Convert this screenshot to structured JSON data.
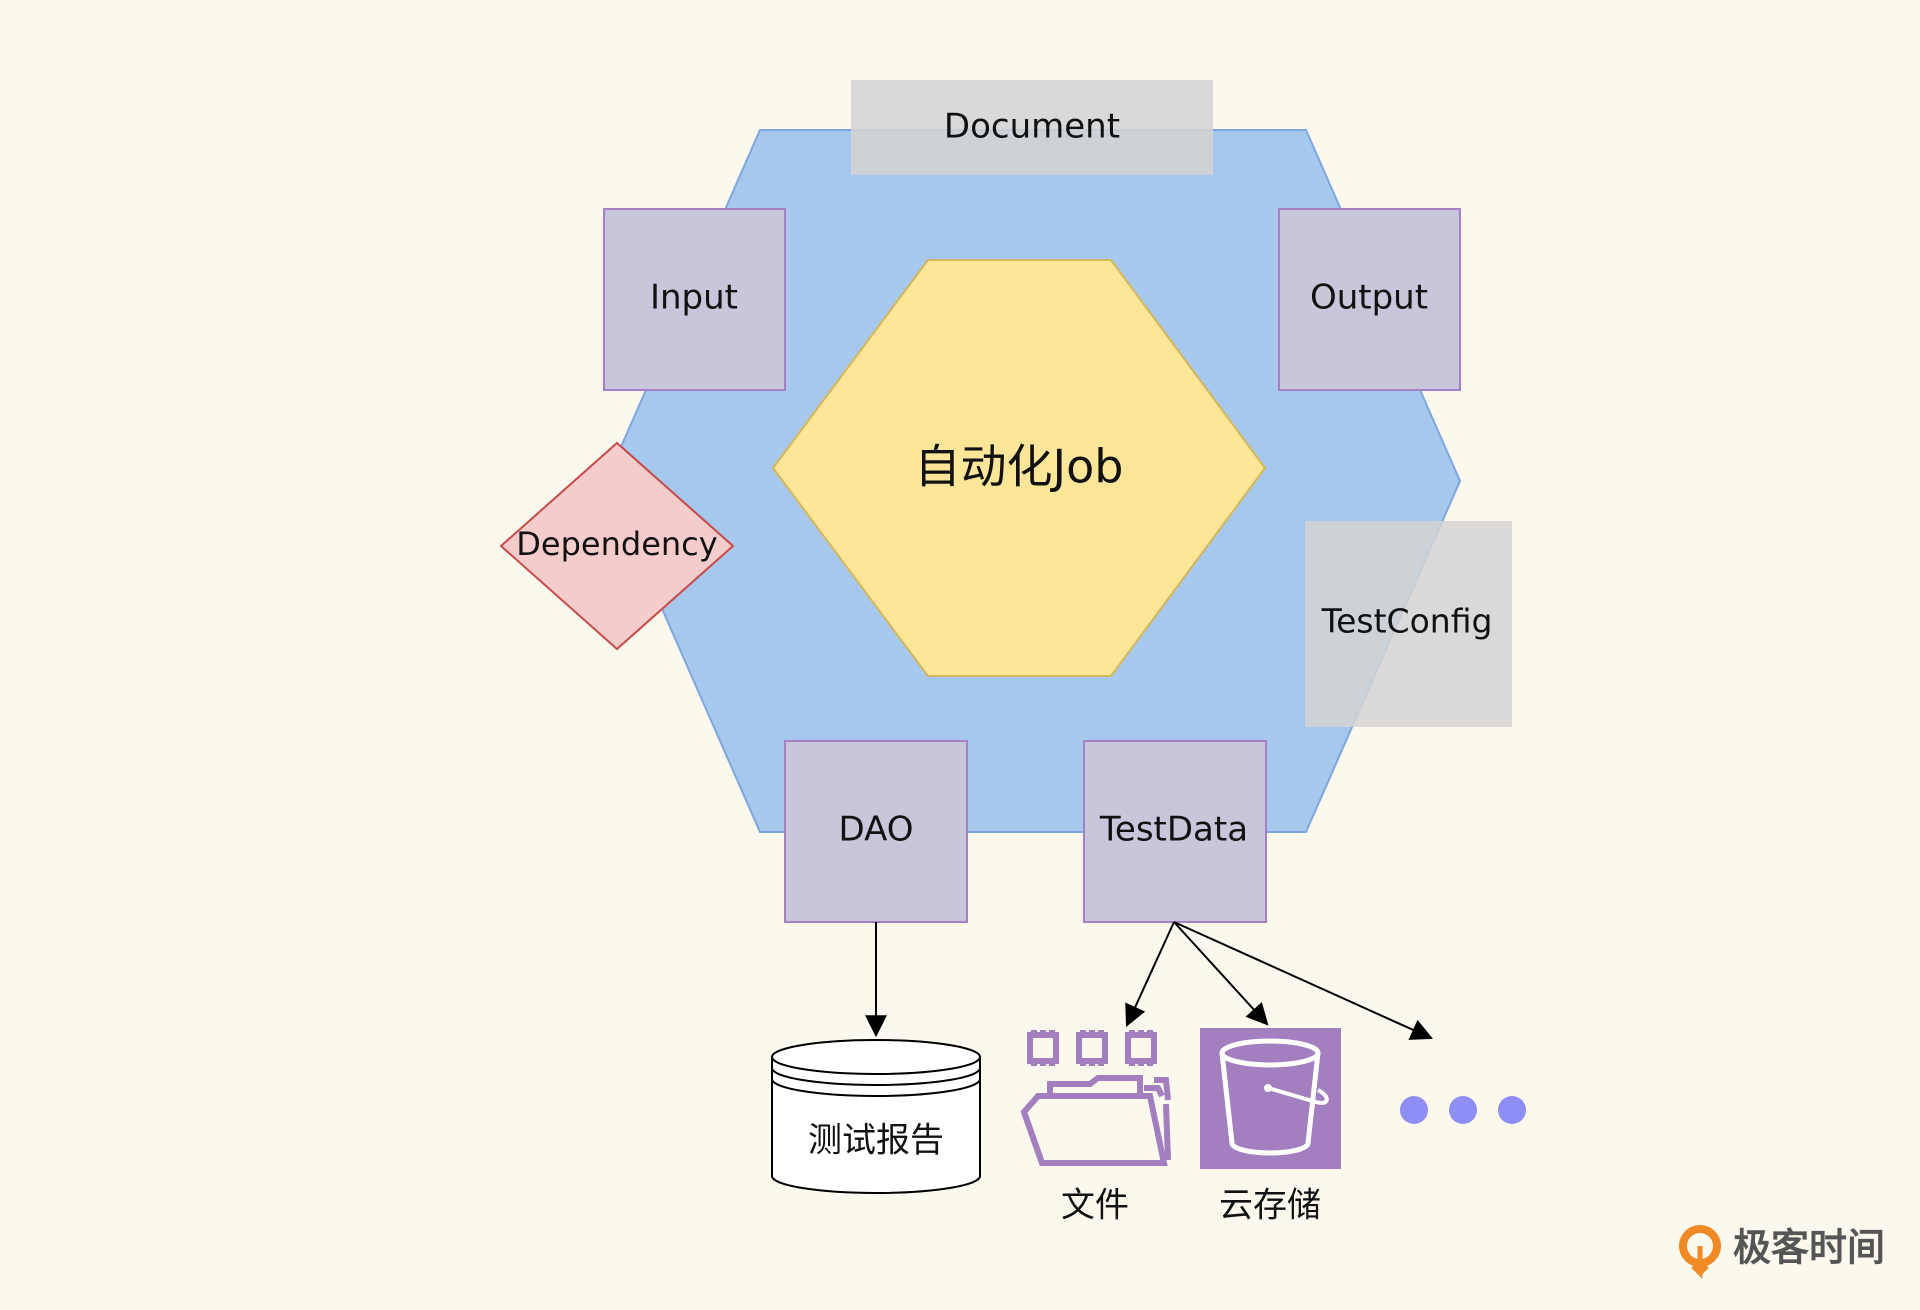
{
  "colors": {
    "background": "#fbf8ee",
    "outer_hexagon_fill": "#a6c8ec",
    "outer_hexagon_stroke": "#7ea6e0",
    "core_fill": "#fee698",
    "core_stroke": "#d6b656",
    "port_fill": "#c8c6da",
    "port_stroke": "#a680c4",
    "gray_box_fill": "#d3d3d3",
    "diamond_fill": "#f5cccc",
    "diamond_stroke": "#c84a4a",
    "icon_purple": "#a47fc0",
    "dots": "#8e8ef5",
    "brand_orange": "#f08a24"
  },
  "core": {
    "label": "自动化Job"
  },
  "ports": {
    "document": "Document",
    "input": "Input",
    "output": "Output",
    "dependency": "Dependency",
    "test_config": "TestConfig",
    "dao": "DAO",
    "test_data": "TestData"
  },
  "storage": {
    "report": "测试报告",
    "file": "文件",
    "cloud": "云存储"
  },
  "brand": {
    "name": "极客时间"
  }
}
